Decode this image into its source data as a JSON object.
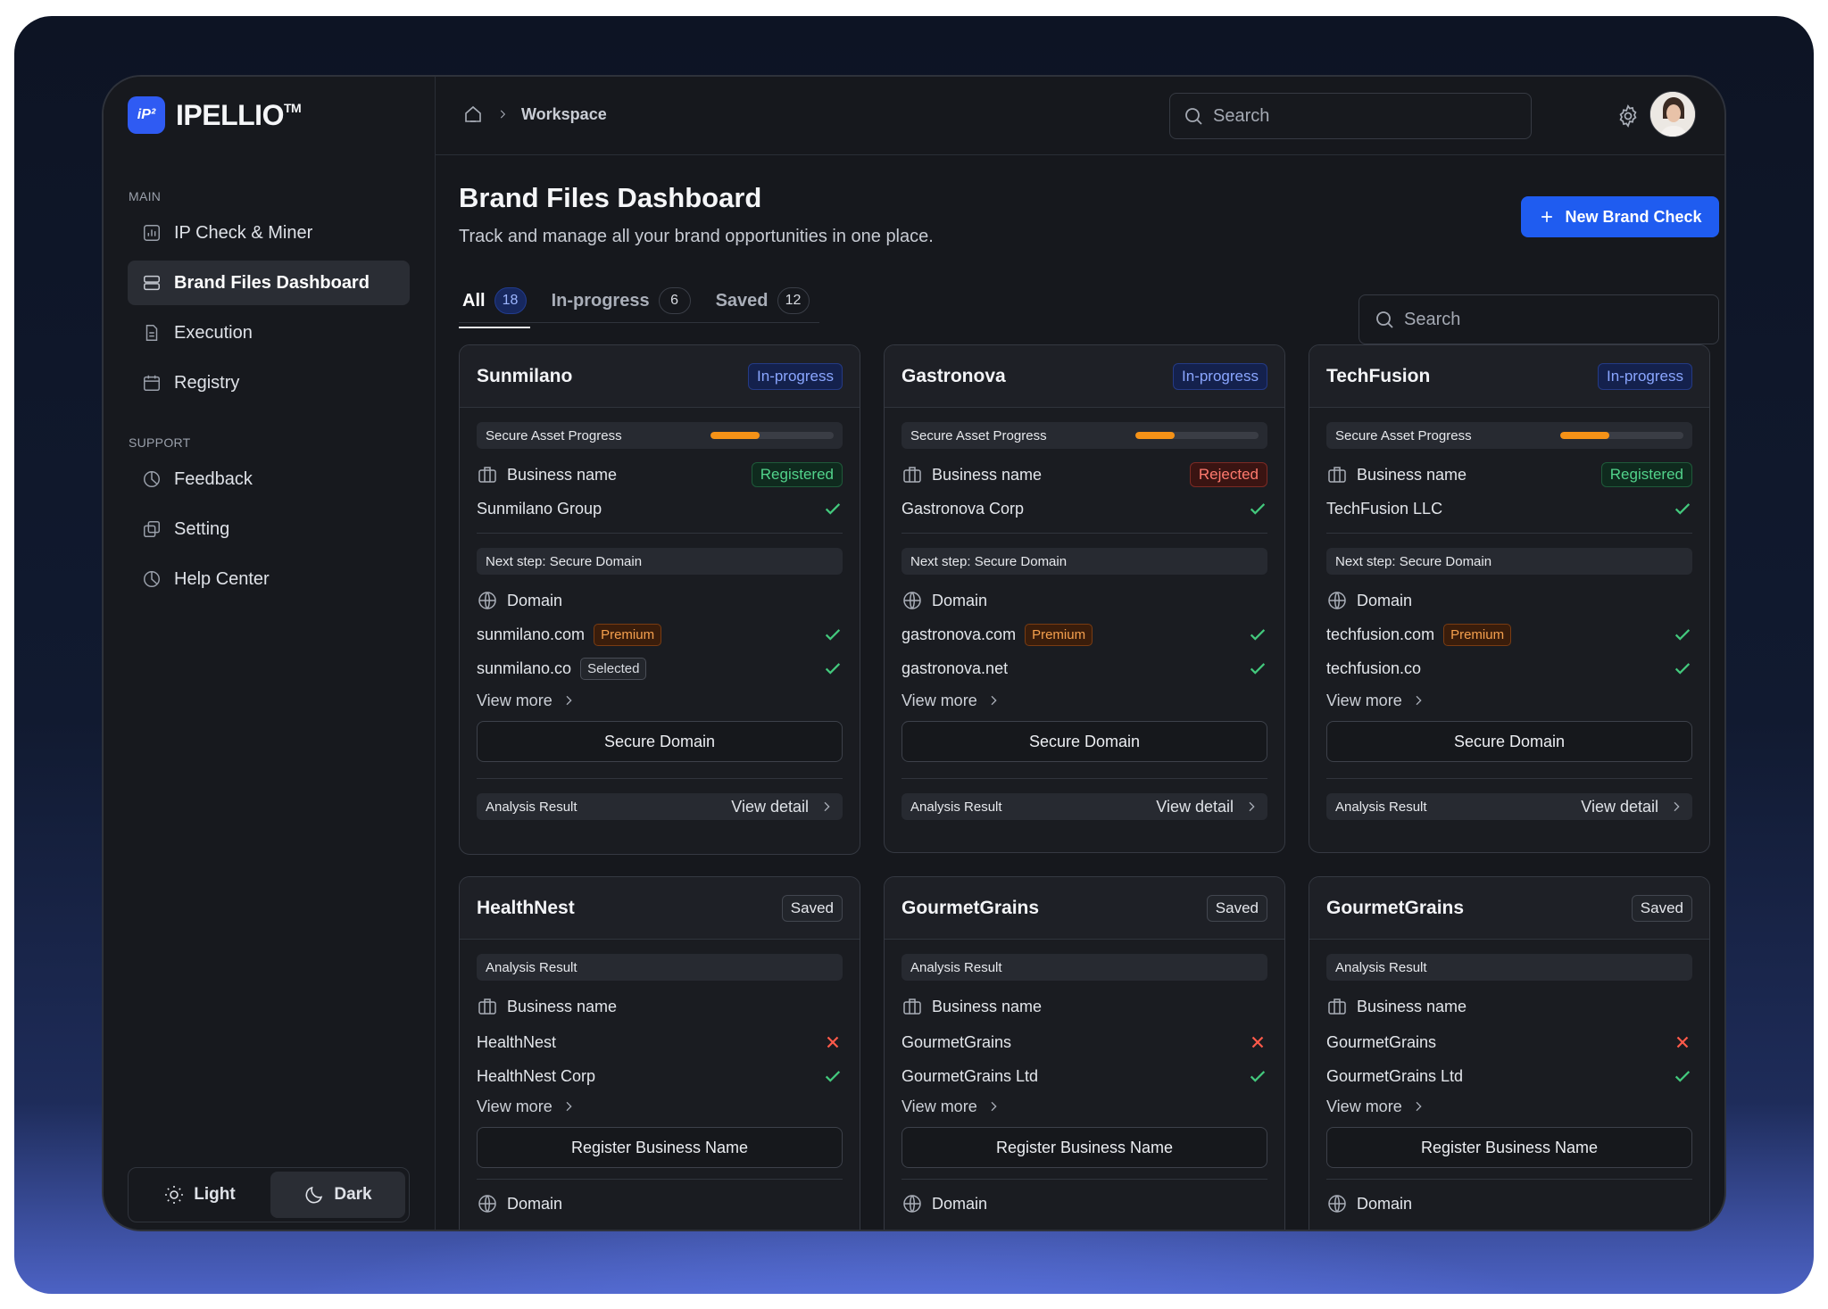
{
  "brand": {
    "name": "IPELLIO",
    "tm": "TM",
    "mark": "iP²"
  },
  "sidebar": {
    "main_label": "MAIN",
    "support_label": "SUPPORT",
    "main_items": [
      {
        "label": "IP Check & Miner",
        "icon": "chart-icon"
      },
      {
        "label": "Brand Files Dashboard",
        "icon": "stack-icon",
        "active": true
      },
      {
        "label": "Execution",
        "icon": "document-icon"
      },
      {
        "label": "Registry",
        "icon": "calendar-icon"
      }
    ],
    "support_items": [
      {
        "label": "Feedback",
        "icon": "pie-icon"
      },
      {
        "label": "Setting",
        "icon": "copy-icon"
      },
      {
        "label": "Help Center",
        "icon": "pie-icon"
      }
    ],
    "theme": {
      "light_label": "Light",
      "dark_label": "Dark",
      "selected": "Dark"
    }
  },
  "header": {
    "breadcrumb": "Workspace",
    "search_placeholder": "Search"
  },
  "main": {
    "title": "Brand Files Dashboard",
    "subtitle": "Track and manage all your brand opportunities in one place.",
    "new_button": "New Brand Check",
    "tabs": [
      {
        "label": "All",
        "count": "18",
        "active": true
      },
      {
        "label": "In-progress",
        "count": "6"
      },
      {
        "label": "Saved",
        "count": "12"
      }
    ],
    "search_placeholder": "Search"
  },
  "cards_progress": [
    {
      "title": "Sunmilano",
      "badge": "In-progress",
      "progress_label": "Secure Asset Progress",
      "progress": 0.4,
      "business_label": "Business name",
      "business_status": "Registered",
      "business_status_type": "ok",
      "business_value": "Sunmilano Group",
      "next_step": "Next step: Secure Domain",
      "domain_label": "Domain",
      "domains": [
        {
          "name": "sunmilano.com",
          "chip": "Premium",
          "chip_type": "premium"
        },
        {
          "name": "sunmilano.co",
          "chip": "Selected",
          "chip_type": "selected"
        }
      ],
      "view_more": "View more",
      "action": "Secure Domain",
      "analysis_label": "Analysis Result",
      "view_detail": "View detail"
    },
    {
      "title": "Gastronova",
      "badge": "In-progress",
      "progress_label": "Secure Asset Progress",
      "progress": 0.32,
      "business_label": "Business name",
      "business_status": "Rejected",
      "business_status_type": "bad",
      "business_value": "Gastronova Corp",
      "next_step": "Next step: Secure Domain",
      "domain_label": "Domain",
      "domains": [
        {
          "name": "gastronova.com",
          "chip": "Premium",
          "chip_type": "premium"
        },
        {
          "name": "gastronova.net",
          "chip": "",
          "chip_type": ""
        }
      ],
      "view_more": "View more",
      "action": "Secure Domain",
      "analysis_label": "Analysis Result",
      "view_detail": "View detail"
    },
    {
      "title": "TechFusion",
      "badge": "In-progress",
      "progress_label": "Secure Asset Progress",
      "progress": 0.4,
      "business_label": "Business name",
      "business_status": "Registered",
      "business_status_type": "ok",
      "business_value": "TechFusion LLC",
      "next_step": "Next step: Secure Domain",
      "domain_label": "Domain",
      "domains": [
        {
          "name": "techfusion.com",
          "chip": "Premium",
          "chip_type": "premium"
        },
        {
          "name": "techfusion.co",
          "chip": "",
          "chip_type": ""
        }
      ],
      "view_more": "View more",
      "action": "Secure Domain",
      "analysis_label": "Analysis Result",
      "view_detail": "View detail"
    }
  ],
  "cards_saved": [
    {
      "title": "HealthNest",
      "badge": "Saved",
      "analysis_label": "Analysis Result",
      "business_label": "Business name",
      "names": [
        {
          "name": "HealthNest",
          "ok": false
        },
        {
          "name": "HealthNest Corp",
          "ok": true
        }
      ],
      "view_more": "View more",
      "action": "Register Business Name",
      "domain_label": "Domain"
    },
    {
      "title": "GourmetGrains",
      "badge": "Saved",
      "analysis_label": "Analysis Result",
      "business_label": "Business name",
      "names": [
        {
          "name": "GourmetGrains",
          "ok": false
        },
        {
          "name": "GourmetGrains Ltd",
          "ok": true
        }
      ],
      "view_more": "View more",
      "action": "Register Business Name",
      "domain_label": "Domain"
    },
    {
      "title": "GourmetGrains",
      "badge": "Saved",
      "analysis_label": "Analysis Result",
      "business_label": "Business name",
      "names": [
        {
          "name": "GourmetGrains",
          "ok": false
        },
        {
          "name": "GourmetGrains Ltd",
          "ok": true
        }
      ],
      "view_more": "View more",
      "action": "Register Business Name",
      "domain_label": "Domain"
    }
  ],
  "colors": {
    "accent": "#1f5cf0",
    "success": "#43c97d",
    "danger": "#ff5a4a",
    "progress": "#f59217"
  }
}
